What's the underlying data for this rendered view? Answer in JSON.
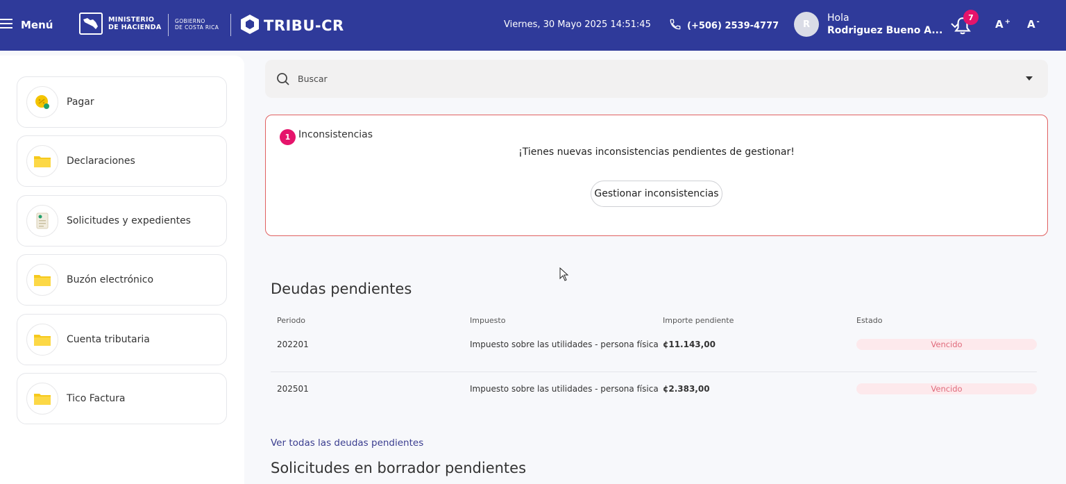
{
  "header": {
    "menu_label": "Menú",
    "ministry_lines": [
      "MINISTERIO",
      "DE HACIENDA"
    ],
    "gobierno_lines": [
      "GOBIERNO",
      "DE COSTA RICA"
    ],
    "brand": "TRIBU-CR",
    "datetime": "Viernes, 30 Mayo 2025 14:51:45",
    "phone": "(+506) 2539-4777",
    "avatar_initial": "R",
    "greeting": "Hola",
    "user_name": "Rodriguez Bueno A...",
    "notification_count": "7",
    "font_increase": "A",
    "font_increase_sup": "+",
    "font_decrease": "A",
    "font_decrease_sup": "-",
    "bg_color": "#2f3a9a"
  },
  "sidebar": {
    "items": [
      {
        "label": "Pagar",
        "icon": "pay-coin-icon"
      },
      {
        "label": "Declaraciones",
        "icon": "folder-icon"
      },
      {
        "label": "Solicitudes y expedientes",
        "icon": "document-icon"
      },
      {
        "label": "Buzón electrónico",
        "icon": "folder-icon"
      },
      {
        "label": "Cuenta tributaria",
        "icon": "folder-icon"
      },
      {
        "label": "Tico Factura",
        "icon": "folder-icon"
      }
    ]
  },
  "search": {
    "placeholder": "Buscar"
  },
  "inconsistencias": {
    "count": "1",
    "title": "Inconsistencias",
    "message": "¡Tienes nuevas inconsistencias pendientes de gestionar!",
    "button": "Gestionar inconsistencias",
    "border_color": "#e06060"
  },
  "deudas": {
    "title": "Deudas pendientes",
    "columns": [
      "Periodo",
      "Impuesto",
      "Importe pendiente",
      "Estado"
    ],
    "rows": [
      {
        "periodo": "202201",
        "impuesto": "Impuesto sobre las utilidades - persona física",
        "importe": "¢11.143,00",
        "estado": "Vencido"
      },
      {
        "periodo": "202501",
        "impuesto": "Impuesto sobre las utilidades - persona física",
        "importe": "¢2.383,00",
        "estado": "Vencido"
      }
    ],
    "view_all": "Ver todas las deudas pendientes"
  },
  "solicitudes": {
    "title": "Solicitudes en borrador pendientes"
  }
}
